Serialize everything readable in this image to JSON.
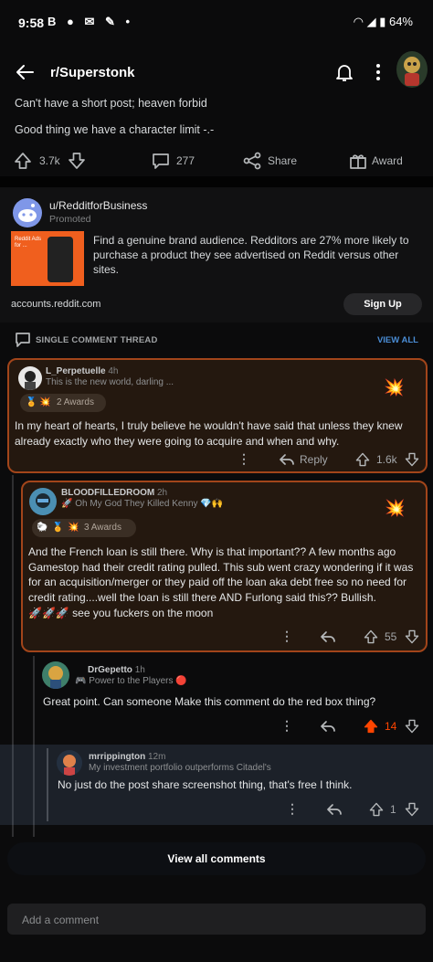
{
  "status_bar": {
    "time": "9:58",
    "left_icons": "B ● ✉ ✎ •",
    "battery": "64%"
  },
  "header": {
    "subreddit": "r/Superstonk"
  },
  "post": {
    "lines": [
      "Can't have a short post; heaven forbid",
      "Good thing we have a character limit -.-"
    ],
    "upvotes": "3.7k",
    "comments": "277",
    "share_label": "Share",
    "award_label": "Award"
  },
  "ad": {
    "user": "u/RedditforBusiness",
    "promoted": "Promoted",
    "image_text": "Reddit Ads for ...",
    "body": "Find a genuine brand audience. Redditors are 27% more likely to purchase a product they see advertised on Reddit versus other sites.",
    "domain": "accounts.reddit.com",
    "cta": "Sign Up"
  },
  "thread": {
    "label": "SINGLE COMMENT THREAD",
    "view_all": "VIEW ALL"
  },
  "comments": [
    {
      "user": "L_Perpetuelle",
      "time": "4h",
      "flair": "This is the new world, darling ...",
      "awards": "2 Awards",
      "body": "In my heart of hearts, I truly believe he wouldn't have said that unless they knew already exactly who they were going to acquire and when and why.",
      "reply_label": "Reply",
      "score": "1.6k"
    },
    {
      "user": "BLOODFILLEDROOM",
      "time": "2h",
      "flair": "🚀 Oh My God They Killed Kenny 💎🙌",
      "awards": "3 Awards",
      "body": "And the French loan is still there. Why is that important?? A few months ago Gamestop had their credit rating pulled. This sub went crazy wondering if it was for an acquisition/merger or they paid off the loan aka debt free so no need for credit rating....well the loan is still there AND Furlong said this?? Bullish.",
      "body2": "🚀🚀🚀 see you fuckers on the moon",
      "score": "55"
    },
    {
      "user": "DrGepetto",
      "time": "1h",
      "flair": "🎮 Power to the Players 🔴",
      "body": "Great point. Can someone Make this comment do the red box thing?",
      "score": "14"
    },
    {
      "user": "mrrippington",
      "time": "12m",
      "flair": "My investment portfolio outperforms Citadel's",
      "body": "No just do the post share screenshot thing, that's free I think.",
      "score": "1"
    }
  ],
  "footer": {
    "view_all_comments": "View all comments",
    "add_comment_placeholder": "Add a comment"
  },
  "colors": {
    "accent_orange": "#ff4500",
    "highlight_border": "#a2451a",
    "link_blue": "#4a8dd6"
  }
}
